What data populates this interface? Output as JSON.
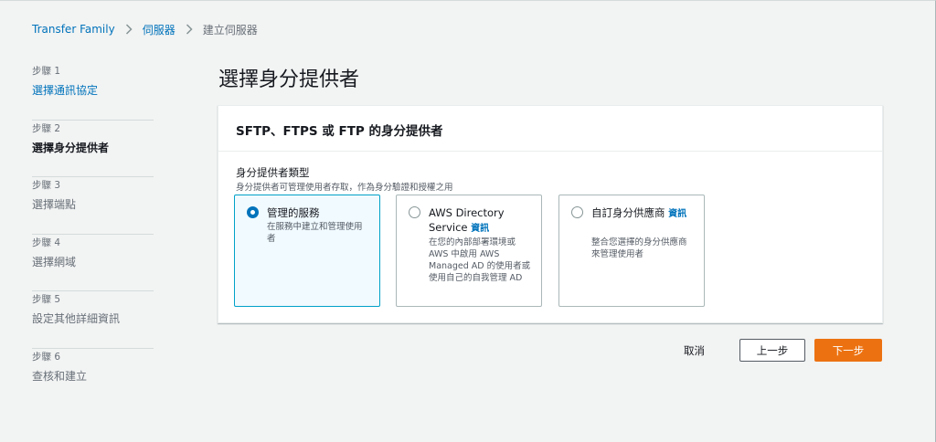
{
  "breadcrumb": {
    "items": [
      {
        "label": "Transfer Family"
      },
      {
        "label": "伺服器"
      },
      {
        "label": "建立伺服器"
      }
    ]
  },
  "steps": [
    {
      "num": "步驟 1",
      "title": "選擇通訊協定"
    },
    {
      "num": "步驟 2",
      "title": "選擇身分提供者"
    },
    {
      "num": "步驟 3",
      "title": "選擇端點"
    },
    {
      "num": "步驟 4",
      "title": "選擇網域"
    },
    {
      "num": "步驟 5",
      "title": "設定其他詳細資訊"
    },
    {
      "num": "步驟 6",
      "title": "查核和建立"
    }
  ],
  "page_title": "選擇身分提供者",
  "panel": {
    "header": "SFTP、FTPS 或 FTP 的身分提供者",
    "field_label": "身分提供者類型",
    "field_desc": "身分提供者可管理使用者存取，作為身分驗證和授權之用",
    "options": [
      {
        "title": "管理的服務",
        "info": "",
        "desc": "在服務中建立和管理使用者",
        "selected": true
      },
      {
        "title": "AWS Directory Service",
        "info": "資訊",
        "desc": "在您的內部部署環境或 AWS 中啟用 AWS Managed AD 的使用者或使用自己的自我管理 AD",
        "selected": false
      },
      {
        "title": "自訂身分供應商",
        "info": "資訊",
        "desc": "整合您選擇的身分供應商來管理使用者",
        "selected": false
      }
    ]
  },
  "actions": {
    "cancel": "取消",
    "previous": "上一步",
    "next": "下一步"
  },
  "colors": {
    "link": "#0073bb",
    "primary": "#ec7211",
    "selected_border": "#00a1c9",
    "selected_bg": "#f1faff",
    "background": "#f2f3f3"
  }
}
